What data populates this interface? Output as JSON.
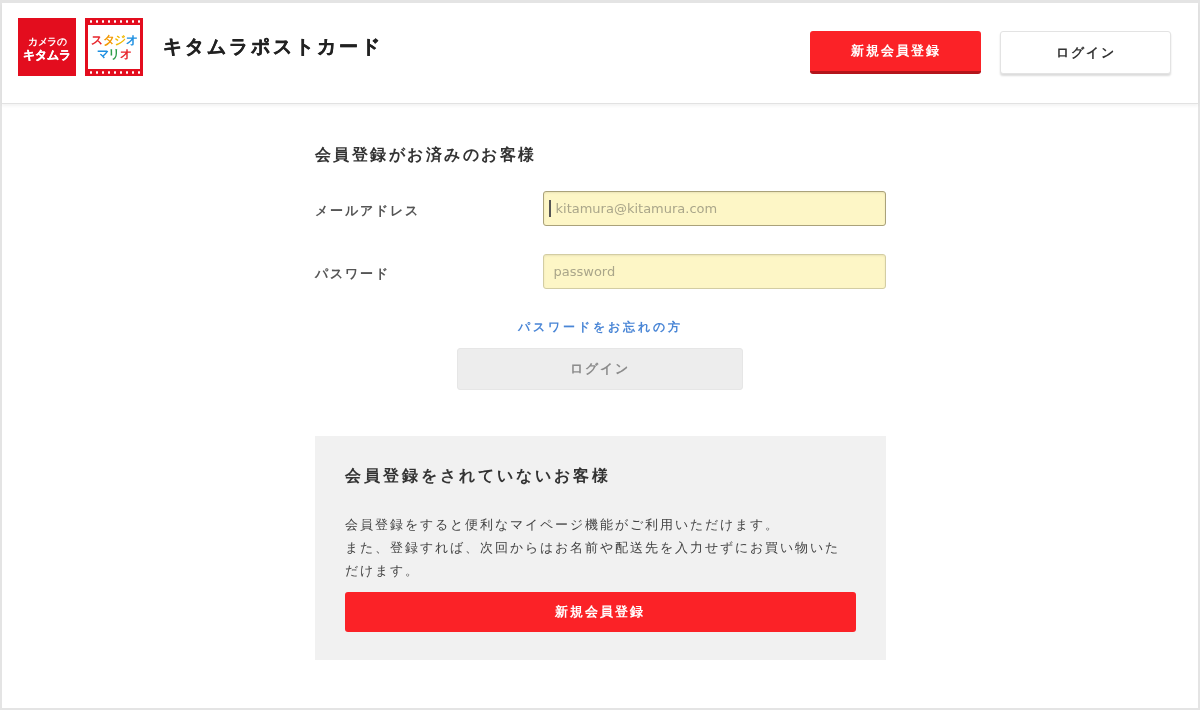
{
  "header": {
    "logos": [
      {
        "kind": "kitamura",
        "lines": [
          "カメラの",
          "キタムラ"
        ]
      },
      {
        "kind": "studio",
        "lines": [
          "スタジオ",
          "マリオ"
        ]
      }
    ],
    "site_title": "キタムラポストカード",
    "buttons": [
      {
        "label": "新規会員登録",
        "kind": "primary"
      },
      {
        "label": "ログイン",
        "kind": "secondary"
      }
    ]
  },
  "member_login": {
    "heading": "会員登録がお済みのお客様",
    "fields": [
      {
        "label": "メールアドレス",
        "placeholder": "kitamura@kitamura.com",
        "focused": true
      },
      {
        "label": "パスワード",
        "placeholder": "password",
        "focused": false
      }
    ],
    "forgot_link": "パスワードをお忘れの方",
    "login_button": {
      "label": "ログイン",
      "disabled": true
    }
  },
  "guest": {
    "heading": "会員登録をされていないお客様",
    "lines": [
      "会員登録をすると便利なマイページ機能がご利用いただけます。",
      "また、登録すれば、次回からはお名前や配送先を入力せずにお買い物いただけます。"
    ],
    "button": {
      "label": "新規会員登録"
    }
  }
}
